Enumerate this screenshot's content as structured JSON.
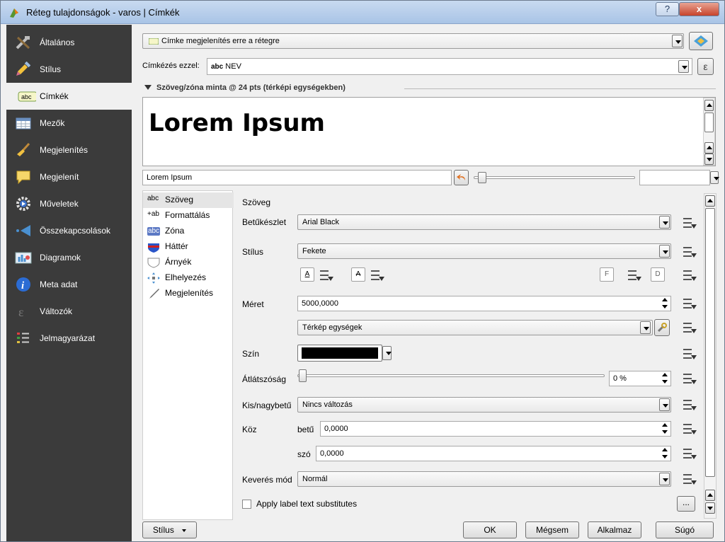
{
  "window": {
    "title": "Réteg tulajdonságok - varos | Címkék",
    "help_label": "?",
    "close_label": "x"
  },
  "sidebar": {
    "items": [
      {
        "label": "Általános",
        "icon": "tools-icon"
      },
      {
        "label": "Stílus",
        "icon": "brush-icon"
      },
      {
        "label": "Címkék",
        "icon": "abc-label-icon",
        "selected": true
      },
      {
        "label": "Mezők",
        "icon": "table-icon"
      },
      {
        "label": "Megjelenítés",
        "icon": "broom-icon"
      },
      {
        "label": "Megjelenít",
        "icon": "speech-bubble-icon"
      },
      {
        "label": "Műveletek",
        "icon": "gear-icon"
      },
      {
        "label": "Összekapcsolások",
        "icon": "join-icon"
      },
      {
        "label": "Diagramok",
        "icon": "chart-icon"
      },
      {
        "label": "Meta adat",
        "icon": "info-icon"
      },
      {
        "label": "Változók",
        "icon": "epsilon-icon"
      },
      {
        "label": "Jelmagyarázat",
        "icon": "legend-icon"
      }
    ]
  },
  "labeling": {
    "mode_value": "Címke megjelenítés erre a rétegre",
    "label_with": "Címkézés ezzel:",
    "field_tag": "abc",
    "field_value": "NEV"
  },
  "preview": {
    "section_title": "Szöveg/zóna minta @ 24 pts (térképi egységekben)",
    "sample_text": "Lorem Ipsum",
    "input_value": "Lorem Ipsum"
  },
  "tabs": [
    {
      "label": "Szöveg",
      "icon": "abc-text-icon",
      "glyph": "abc"
    },
    {
      "label": "Formattálás",
      "icon": "format-icon",
      "glyph": "+ab"
    },
    {
      "label": "Zóna",
      "icon": "buffer-icon",
      "glyph": "abc"
    },
    {
      "label": "Háttér",
      "icon": "background-icon",
      "glyph": ""
    },
    {
      "label": "Árnyék",
      "icon": "shadow-icon",
      "glyph": ""
    },
    {
      "label": "Elhelyezés",
      "icon": "placement-icon",
      "glyph": ""
    },
    {
      "label": "Megjelenítés",
      "icon": "rendering-icon",
      "glyph": ""
    }
  ],
  "text": {
    "heading": "Szöveg",
    "font_label": "Betűkészlet",
    "font_value": "Arial Black",
    "style_label": "Stílus",
    "style_value": "Fekete",
    "btn_underline": "A",
    "btn_strike": "A",
    "btn_bold": "F",
    "btn_italic": "D",
    "size_label": "Méret",
    "size_value": "5000,0000",
    "unit_value": "Térkép egységek",
    "color_label": "Szín",
    "color_value": "#000000",
    "opacity_label": "Átlátszóság",
    "opacity_value": "0 %",
    "case_label": "Kis/nagybetű",
    "case_value": "Nincs változás",
    "spacing_label": "Köz",
    "letter_label": "betű",
    "letter_value": "0,0000",
    "word_label": "szó",
    "word_value": "0,0000",
    "blend_label": "Keverés mód",
    "blend_value": "Normál",
    "substitutes_label": "Apply label text substitutes",
    "substitutes_btn": "..."
  },
  "footer": {
    "style_btn": "Stílus",
    "ok": "OK",
    "cancel": "Mégsem",
    "apply": "Alkalmaz",
    "help": "Súgó"
  }
}
